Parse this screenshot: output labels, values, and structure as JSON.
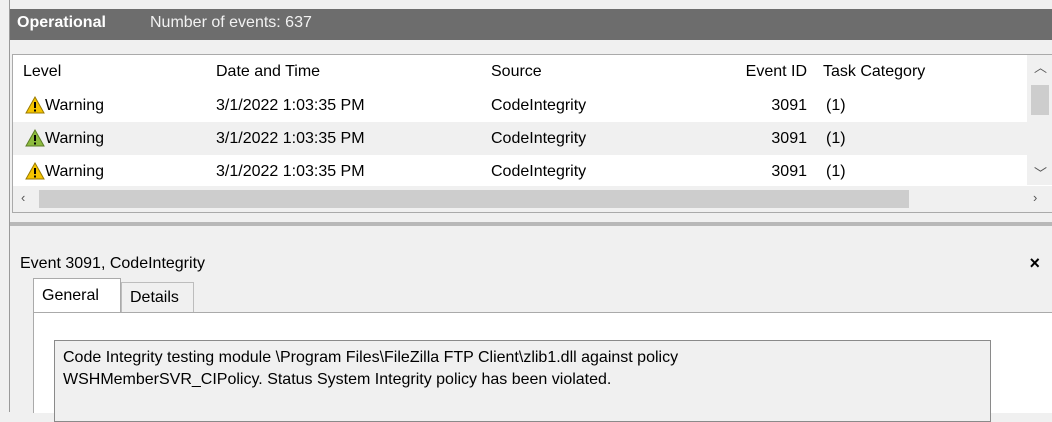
{
  "header": {
    "name": "Operational",
    "count": "Number of events: 637"
  },
  "columns": [
    "Level",
    "Date and Time",
    "Source",
    "Event ID",
    "Task Category"
  ],
  "rows": [
    {
      "level": "Warning",
      "datetime": "3/1/2022 1:03:35 PM",
      "source": "CodeIntegrity",
      "event_id": "3091",
      "task": "(1)"
    },
    {
      "level": "Warning",
      "datetime": "3/1/2022 1:03:35 PM",
      "source": "CodeIntegrity",
      "event_id": "3091",
      "task": "(1)"
    },
    {
      "level": "Warning",
      "datetime": "3/1/2022 1:03:35 PM",
      "source": "CodeIntegrity",
      "event_id": "3091",
      "task": "(1)"
    }
  ],
  "detail": {
    "title": "Event 3091, CodeIntegrity",
    "close": "×",
    "tabs": [
      "General",
      "Details"
    ],
    "message": "Code Integrity testing module \\Program Files\\FileZilla FTP Client\\zlib1.dll against policy\nWSHMemberSVR_CIPolicy. Status System Integrity policy has been violated."
  },
  "icons": {
    "level": "warning-icon"
  },
  "colors": {
    "header_bg": "#6d6d6d",
    "warning_yellow": "#f5c400",
    "alt_row": "#f0f0f0"
  }
}
